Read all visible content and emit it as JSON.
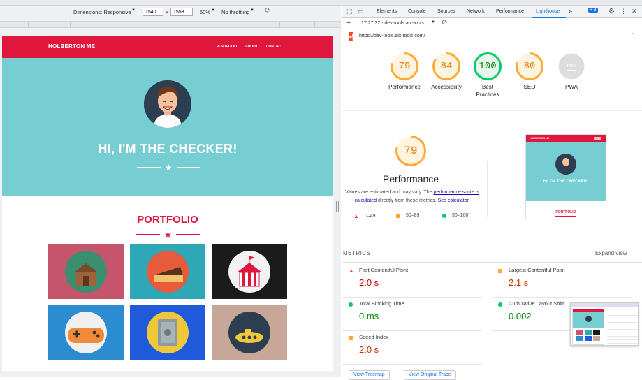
{
  "devtools_toolbar": {
    "dimensions_label": "Dimensions: Responsive",
    "width": "1540",
    "times": "×",
    "height": "1558",
    "zoom": "50%",
    "throttling": "No throttling"
  },
  "site": {
    "brand": "HOLBERTON ME",
    "nav": [
      "PORTFOLIO",
      "ABOUT",
      "CONTACT"
    ],
    "hero_title": "HI, I'M THE CHECKER!",
    "section_title": "PORTFOLIO"
  },
  "tabs": [
    "Elements",
    "Console",
    "Sources",
    "Network",
    "Performance",
    "Lighthouse"
  ],
  "active_tab": "Lighthouse",
  "more_tabs": "»",
  "issues_count": "8",
  "lighthouse": {
    "report_time": "17:27:32 - dev-tools.alx-tools....",
    "url": "https://dev-tools.alx-tools.com/",
    "scores": [
      {
        "value": "79",
        "label": "Performance",
        "color": "#e67700",
        "ring": "#fa3",
        "fill": 0.79
      },
      {
        "value": "84",
        "label": "Accessibility",
        "color": "#e67700",
        "ring": "#fa3",
        "fill": 0.84
      },
      {
        "value": "100",
        "label": "Best Practices",
        "color": "#008800",
        "ring": "#0c6",
        "fill": 1.0
      },
      {
        "value": "80",
        "label": "SEO",
        "color": "#e67700",
        "ring": "#fa3",
        "fill": 0.8
      },
      {
        "value": "PWA",
        "label": "PWA",
        "color": "#ffffff",
        "ring": "#ccc",
        "fill": 0
      }
    ],
    "perf_score": "79",
    "perf_title": "Performance",
    "perf_note_1": "Values are estimated and may vary. The",
    "perf_note_link1": "performance score is calculated",
    "perf_note_2": "directly from these metrics.",
    "perf_note_link2": "See calculator.",
    "legend": [
      "0–49",
      "50–89",
      "90–100"
    ],
    "metrics_title": "METRICS",
    "expand_view": "Expand view",
    "metrics": [
      {
        "label": "First Contentful Paint",
        "value": "2.0 s",
        "status": "fail"
      },
      {
        "label": "Largest Contentful Paint",
        "value": "2.1 s",
        "status": "average"
      },
      {
        "label": "Total Blocking Time",
        "value": "0 ms",
        "status": "pass"
      },
      {
        "label": "Cumulative Layout Shift",
        "value": "0.002",
        "status": "pass"
      },
      {
        "label": "Speed Index",
        "value": "2.0 s",
        "status": "average"
      }
    ],
    "buttons": [
      "View Treemap",
      "View Original Trace"
    ]
  },
  "thumbnail": {
    "brand": "HOLBERTON ME",
    "title": "HI, I'M THE CHECKER!",
    "section": "PORTFOLIO"
  },
  "colors": {
    "accent_red": "#e0173d",
    "hero_teal": "#76cdd2",
    "fail": "#f33",
    "average": "#fa3",
    "pass": "#0c6"
  }
}
